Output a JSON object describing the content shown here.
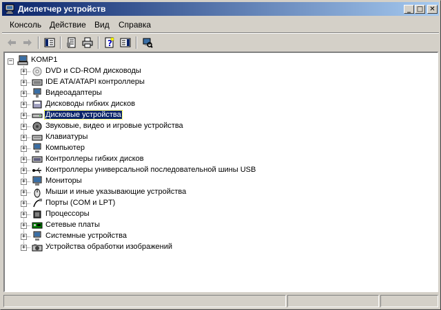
{
  "window": {
    "title": "Диспетчер устройств",
    "caption_buttons": {
      "minimize": "_",
      "maximize": "□",
      "close": "✕"
    }
  },
  "menu": [
    {
      "label": "Консоль"
    },
    {
      "label": "Действие"
    },
    {
      "label": "Вид"
    },
    {
      "label": "Справка"
    }
  ],
  "toolbar": [
    {
      "icon": "back-arrow-icon"
    },
    {
      "icon": "forward-arrow-icon"
    },
    {
      "icon": "show-hide-console-tree-icon"
    },
    {
      "icon": "properties-icon"
    },
    {
      "icon": "print-icon"
    },
    {
      "icon": "help-icon"
    },
    {
      "icon": "show-hide-action-pane-icon"
    },
    {
      "icon": "scan-hardware-icon"
    }
  ],
  "tree": {
    "root": {
      "label": "KOMP1",
      "icon": "computer-icon",
      "expander": "−"
    },
    "items": [
      {
        "label": "DVD и CD-ROM дисководы",
        "icon": "cdrom-icon",
        "expander": "+"
      },
      {
        "label": "IDE ATA/ATAPI контроллеры",
        "icon": "ide-controller-icon",
        "expander": "+"
      },
      {
        "label": "Видеоадаптеры",
        "icon": "display-adapter-icon",
        "expander": "+"
      },
      {
        "label": "Дисководы гибких дисков",
        "icon": "floppy-drive-icon",
        "expander": "+"
      },
      {
        "label": "Дисковые устройства",
        "icon": "disk-drive-icon",
        "expander": "+",
        "selected": true
      },
      {
        "label": "Звуковые, видео и игровые устройства",
        "icon": "sound-icon",
        "expander": "+"
      },
      {
        "label": "Клавиатуры",
        "icon": "keyboard-icon",
        "expander": "+"
      },
      {
        "label": "Компьютер",
        "icon": "computer-class-icon",
        "expander": "+"
      },
      {
        "label": "Контроллеры гибких дисков",
        "icon": "floppy-controller-icon",
        "expander": "+"
      },
      {
        "label": "Контроллеры универсальной последовательной шины USB",
        "icon": "usb-icon",
        "expander": "+"
      },
      {
        "label": "Мониторы",
        "icon": "monitor-icon",
        "expander": "+"
      },
      {
        "label": "Мыши и иные указывающие устройства",
        "icon": "mouse-icon",
        "expander": "+"
      },
      {
        "label": "Порты (COM и LPT)",
        "icon": "port-icon",
        "expander": "+"
      },
      {
        "label": "Процессоры",
        "icon": "processor-icon",
        "expander": "+"
      },
      {
        "label": "Сетевые платы",
        "icon": "network-card-icon",
        "expander": "+"
      },
      {
        "label": "Системные устройства",
        "icon": "system-devices-icon",
        "expander": "+"
      },
      {
        "label": "Устройства обработки изображений",
        "icon": "imaging-device-icon",
        "expander": "+"
      }
    ]
  },
  "colors": {
    "title_start": "#0a246a",
    "title_end": "#a6caf0",
    "selection": "#0a246a",
    "face": "#d4d0c8"
  }
}
